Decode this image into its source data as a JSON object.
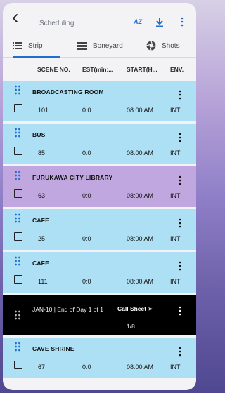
{
  "header": {
    "title": "Scheduling",
    "sort_label": "AZ",
    "icons": {
      "back": "back-arrow-icon",
      "download": "download-icon",
      "more": "more-vert-icon"
    }
  },
  "tabs": [
    {
      "label": "Strip",
      "icon": "list-icon",
      "active": true
    },
    {
      "label": "Boneyard",
      "icon": "stack-icon",
      "active": false
    },
    {
      "label": "Shots",
      "icon": "shutter-icon",
      "active": false
    }
  ],
  "columns": {
    "scene": "SCENE NO.",
    "est": "EST(min:...",
    "start": "START(H...",
    "env": "ENV."
  },
  "rows": [
    {
      "name": "BROADCASTING ROOM",
      "scene": "101",
      "est": "0:0",
      "start": "08:00 AM",
      "env": "INT",
      "color": "#aee0f5"
    },
    {
      "name": "BUS",
      "scene": "85",
      "est": "0:0",
      "start": "08:00 AM",
      "env": "INT",
      "color": "#aee0f5"
    },
    {
      "name": "FURUKAWA CITY LIBRARY",
      "scene": "63",
      "est": "0:0",
      "start": "08:00 AM",
      "env": "INT",
      "color": "#c1a7df"
    },
    {
      "name": "CAFE",
      "scene": "25",
      "est": "0:0",
      "start": "08:00 AM",
      "env": "INT",
      "color": "#aee0f5"
    },
    {
      "name": "CAFE",
      "scene": "111",
      "est": "0:0",
      "start": "08:00 AM",
      "env": "INT",
      "color": "#aee0f5"
    }
  ],
  "day_break": {
    "text": "JAN-10 | End of Day 1 of 1",
    "callsheet": "Call Sheet ➣",
    "fraction": "1/8"
  },
  "last_row": {
    "name": "CAVE SHRINE",
    "scene": "67",
    "est": "0:0",
    "start": "08:00 AM",
    "env": "INT",
    "color": "#aee0f5"
  },
  "colors": {
    "accent": "#1f6fd1",
    "strip_blue": "#aee0f5",
    "strip_purple": "#c1a7df",
    "day_break": "#000000"
  }
}
